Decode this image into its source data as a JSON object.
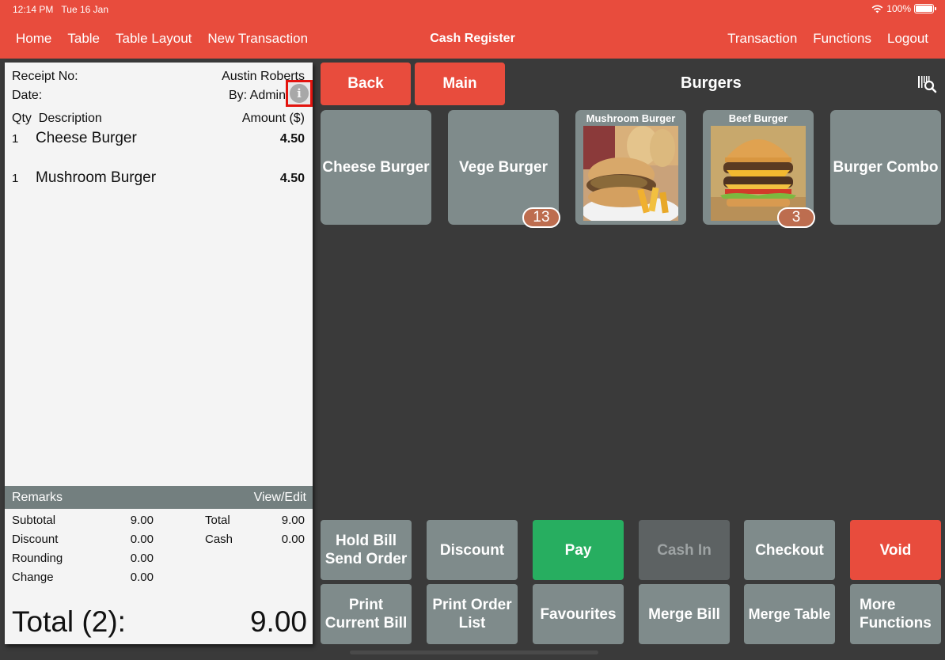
{
  "status_bar": {
    "time": "12:14 PM",
    "date": "Tue 16 Jan",
    "battery": "100%"
  },
  "nav": {
    "left": [
      "Home",
      "Table",
      "Table Layout",
      "New Transaction"
    ],
    "title": "Cash Register",
    "right": [
      "Transaction",
      "Functions",
      "Logout"
    ]
  },
  "receipt": {
    "receipt_no_label": "Receipt No:",
    "customer": "Austin Roberts",
    "date_label": "Date:",
    "by": "By: Admin",
    "col_qty": "Qty",
    "col_desc": "Description",
    "col_amount": "Amount ($)",
    "items": [
      {
        "qty": "1",
        "desc": "Cheese Burger",
        "amount": "4.50"
      },
      {
        "qty": "1",
        "desc": "Mushroom Burger",
        "amount": "4.50"
      }
    ],
    "remarks_label": "Remarks",
    "remarks_action": "View/Edit",
    "summary": {
      "subtotal_label": "Subtotal",
      "subtotal": "9.00",
      "discount_label": "Discount",
      "discount": "0.00",
      "rounding_label": "Rounding",
      "rounding": "0.00",
      "change_label": "Change",
      "change": "0.00",
      "total_label": "Total",
      "total": "9.00",
      "cash_label": "Cash",
      "cash": "0.00"
    },
    "grand_total_label": "Total (2):",
    "grand_total": "9.00"
  },
  "menu": {
    "back_label": "Back",
    "main_label": "Main",
    "category_title": "Burgers",
    "tiles": [
      {
        "name": "Cheese Burger",
        "image": false
      },
      {
        "name": "Vege Burger",
        "image": false,
        "badge": "13"
      },
      {
        "name": "Mushroom Burger",
        "image": true
      },
      {
        "name": "Beef Burger",
        "image": true,
        "badge": "3"
      },
      {
        "name": "Burger Combo",
        "image": false
      }
    ]
  },
  "functions": {
    "row1": [
      "Hold Bill\nSend Order",
      "Discount",
      "Pay",
      "Cash In",
      "Checkout",
      "Void"
    ],
    "row2": [
      "Print\nCurrent Bill",
      "Print Order\nList",
      "Favourites",
      "Merge Bill",
      "Merge Table",
      "More\nFunctions"
    ]
  },
  "colors": {
    "brand": "#e84c3d",
    "pay": "#27ae60",
    "tile": "#7f8b8b",
    "badge": "#bd6d4f"
  }
}
